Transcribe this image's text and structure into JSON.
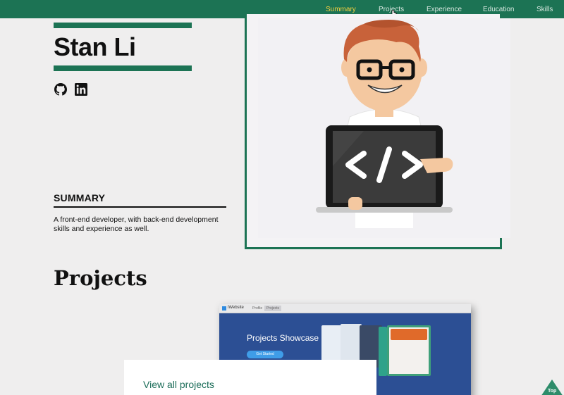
{
  "nav": {
    "items": [
      {
        "label": "Summary",
        "active": true
      },
      {
        "label": "Projects",
        "active": false
      },
      {
        "label": "Experience",
        "active": false
      },
      {
        "label": "Education",
        "active": false
      },
      {
        "label": "Skills",
        "active": false
      }
    ]
  },
  "profile": {
    "first_name": "Stan",
    "last_name": "Li",
    "social": [
      "github-icon",
      "linkedin-icon"
    ]
  },
  "summary": {
    "heading": "SUMMARY",
    "text": "A front-end developer, with back-end development skills and experience as well."
  },
  "projects": {
    "title": "Projects",
    "screenshot": {
      "brand": "iWebsite",
      "tabs": [
        "Profile",
        "Projects"
      ],
      "headline": "Projects Showcase",
      "button": "Get Started"
    },
    "view_all": "View all projects"
  },
  "top_button": {
    "label": "Top"
  },
  "colors": {
    "brand_green": "#1c7354",
    "nav_active": "#f4d03f",
    "background": "#efeeee"
  }
}
